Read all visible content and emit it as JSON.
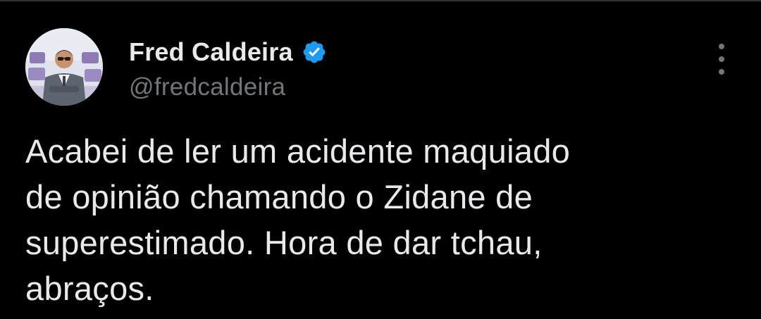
{
  "author": {
    "display_name": "Fred Caldeira",
    "handle": "@fredcaldeira",
    "verified": true
  },
  "tweet": {
    "text": "Acabei de ler um acidente maquiado\nde opinião chamando o Zidane de\nsuperestimado. Hora de dar tchau,\nabraços."
  },
  "icons": {
    "verified": "verified-badge-icon",
    "more": "more-vertical-icon"
  },
  "colors": {
    "background": "#000000",
    "text_primary": "#e7e9ea",
    "text_secondary": "#71767b",
    "verified_blue": "#1d9bf0"
  }
}
